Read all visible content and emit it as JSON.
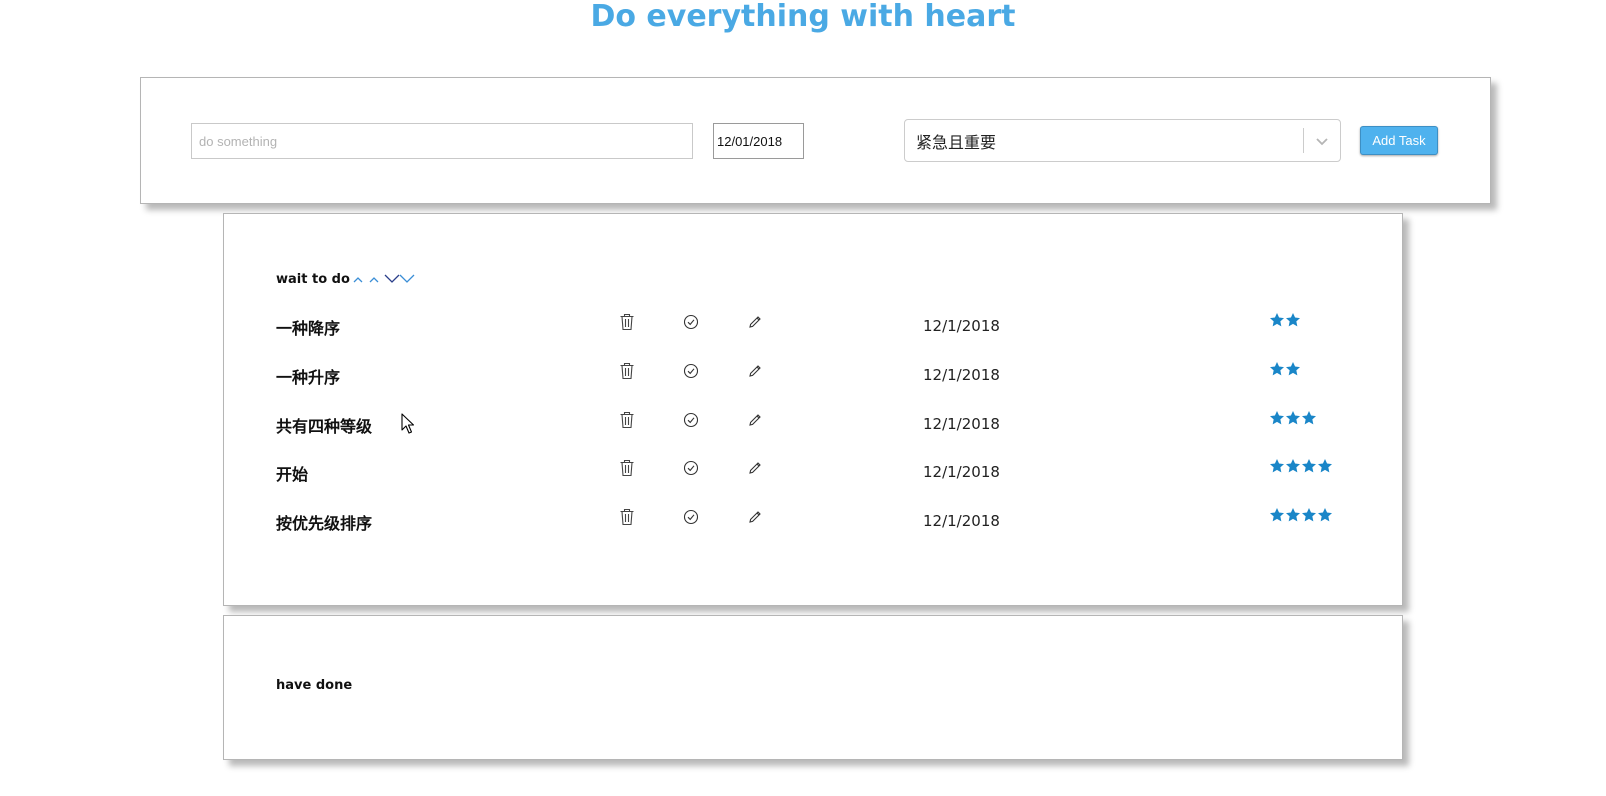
{
  "page": {
    "title": "Do everything with heart"
  },
  "add_task": {
    "task_placeholder": "do something",
    "task_value": "",
    "date_value": "12/01/2018",
    "priority_selected": "紧急且重要",
    "add_button_label": "Add Task"
  },
  "wait": {
    "header": "wait to do",
    "tasks": [
      {
        "title": "一种降序",
        "date": "12/1/2018",
        "priority_stars": 2
      },
      {
        "title": "一种升序",
        "date": "12/1/2018",
        "priority_stars": 2
      },
      {
        "title": "共有四种等级",
        "date": "12/1/2018",
        "priority_stars": 3
      },
      {
        "title": "开始",
        "date": "12/1/2018",
        "priority_stars": 4
      },
      {
        "title": "按优先级排序",
        "date": "12/1/2018",
        "priority_stars": 4
      }
    ]
  },
  "done": {
    "header": "have done",
    "tasks": []
  },
  "colors": {
    "title": "#4aa9e4",
    "star": "#1a86c8",
    "add_button": "#4fb2ee",
    "sort_arrows": "#3a8ed6"
  },
  "icons": {
    "delete": "trash-icon",
    "complete": "check-circle-icon",
    "edit": "pencil-icon",
    "priority": "star-icon",
    "sort": [
      "chevron-up-icon",
      "chevron-up-icon",
      "chevron-down-icon",
      "chevron-down-icon"
    ]
  }
}
